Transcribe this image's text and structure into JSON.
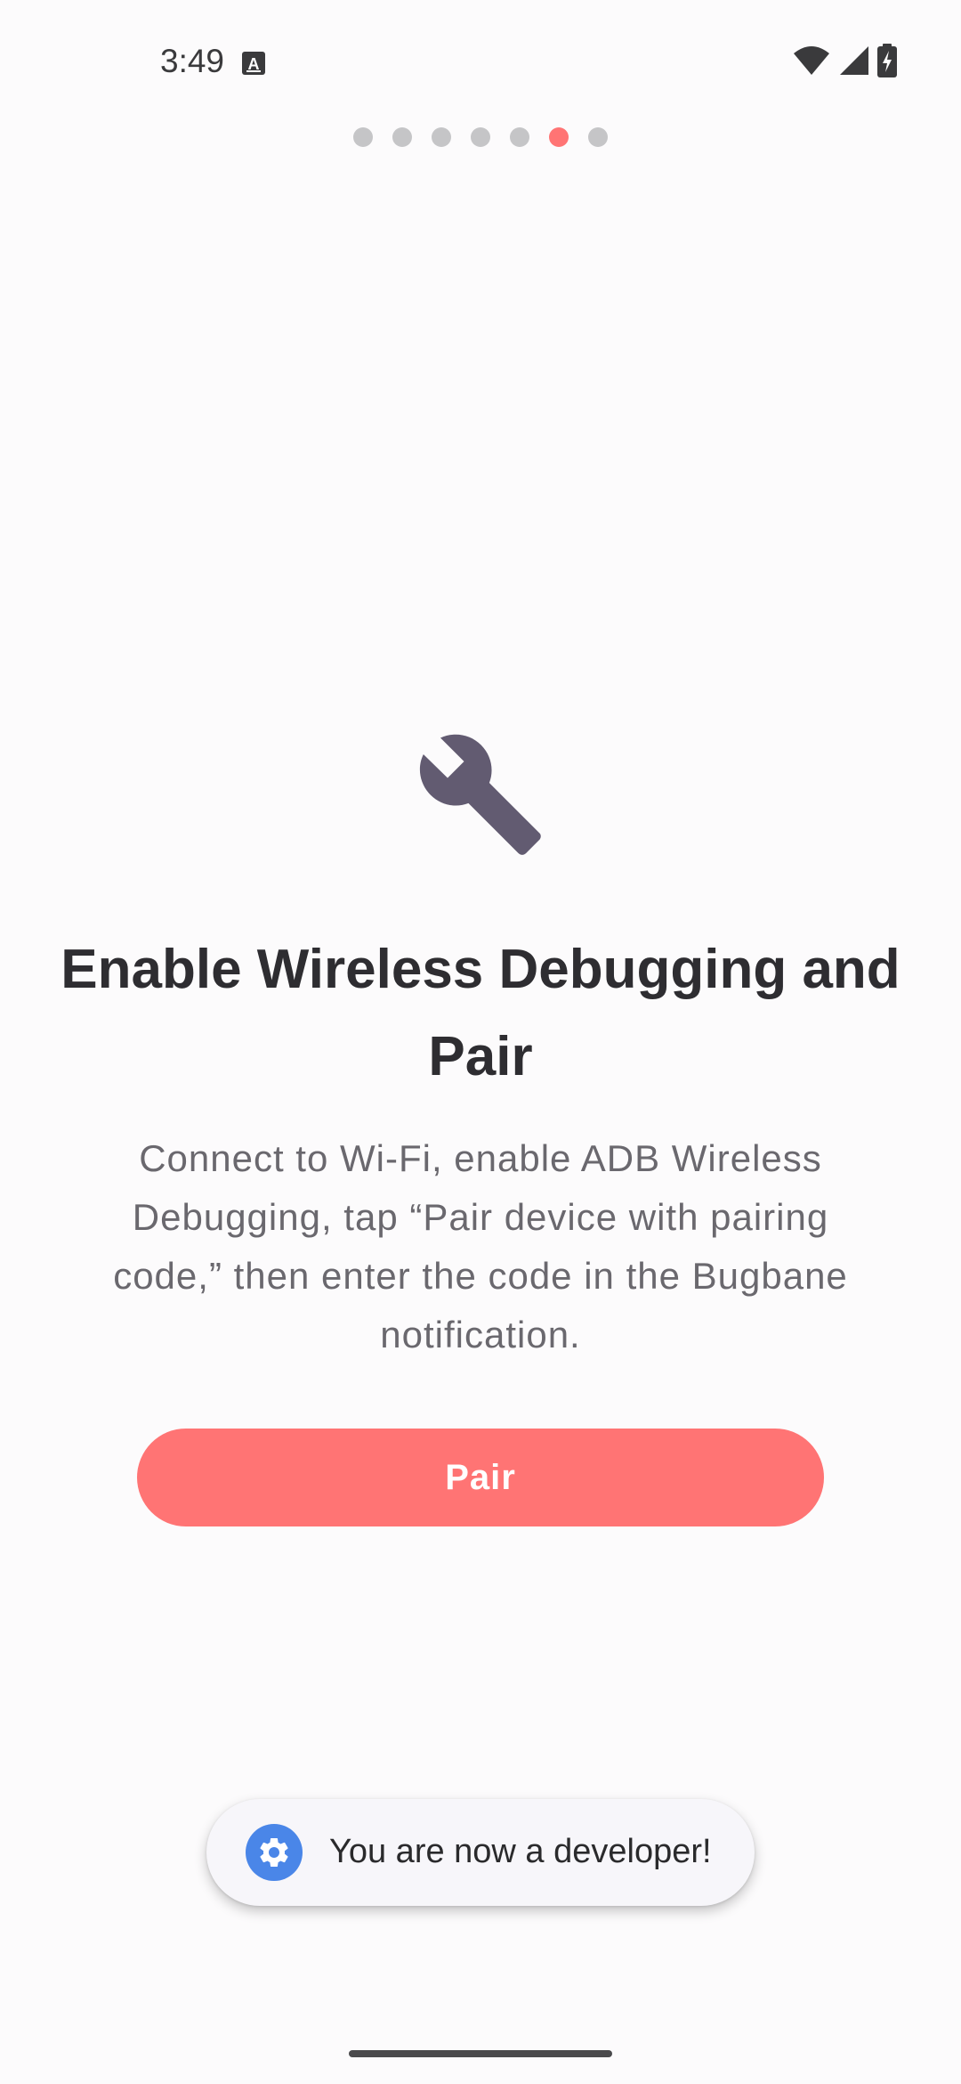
{
  "status_bar": {
    "time": "3:49",
    "icons": [
      "keyboard-a-icon",
      "wifi-icon",
      "cell-signal-icon",
      "battery-charging-icon"
    ]
  },
  "pager": {
    "total": 7,
    "active_index": 5
  },
  "colors": {
    "accent": "#ff7474",
    "icon": "#625b71",
    "background": "#fcfbfc",
    "dot_inactive": "#c5c5c7"
  },
  "content": {
    "icon": "wrench-icon",
    "title": "Enable Wireless Debugging and Pair",
    "description": "Connect to Wi-Fi, enable ADB Wireless Debugging, tap “Pair device with pairing code,” then enter the code in the Bugbane notification.",
    "button_label": "Pair"
  },
  "toast": {
    "icon": "settings-gear-icon",
    "text": "You are now a developer!"
  }
}
